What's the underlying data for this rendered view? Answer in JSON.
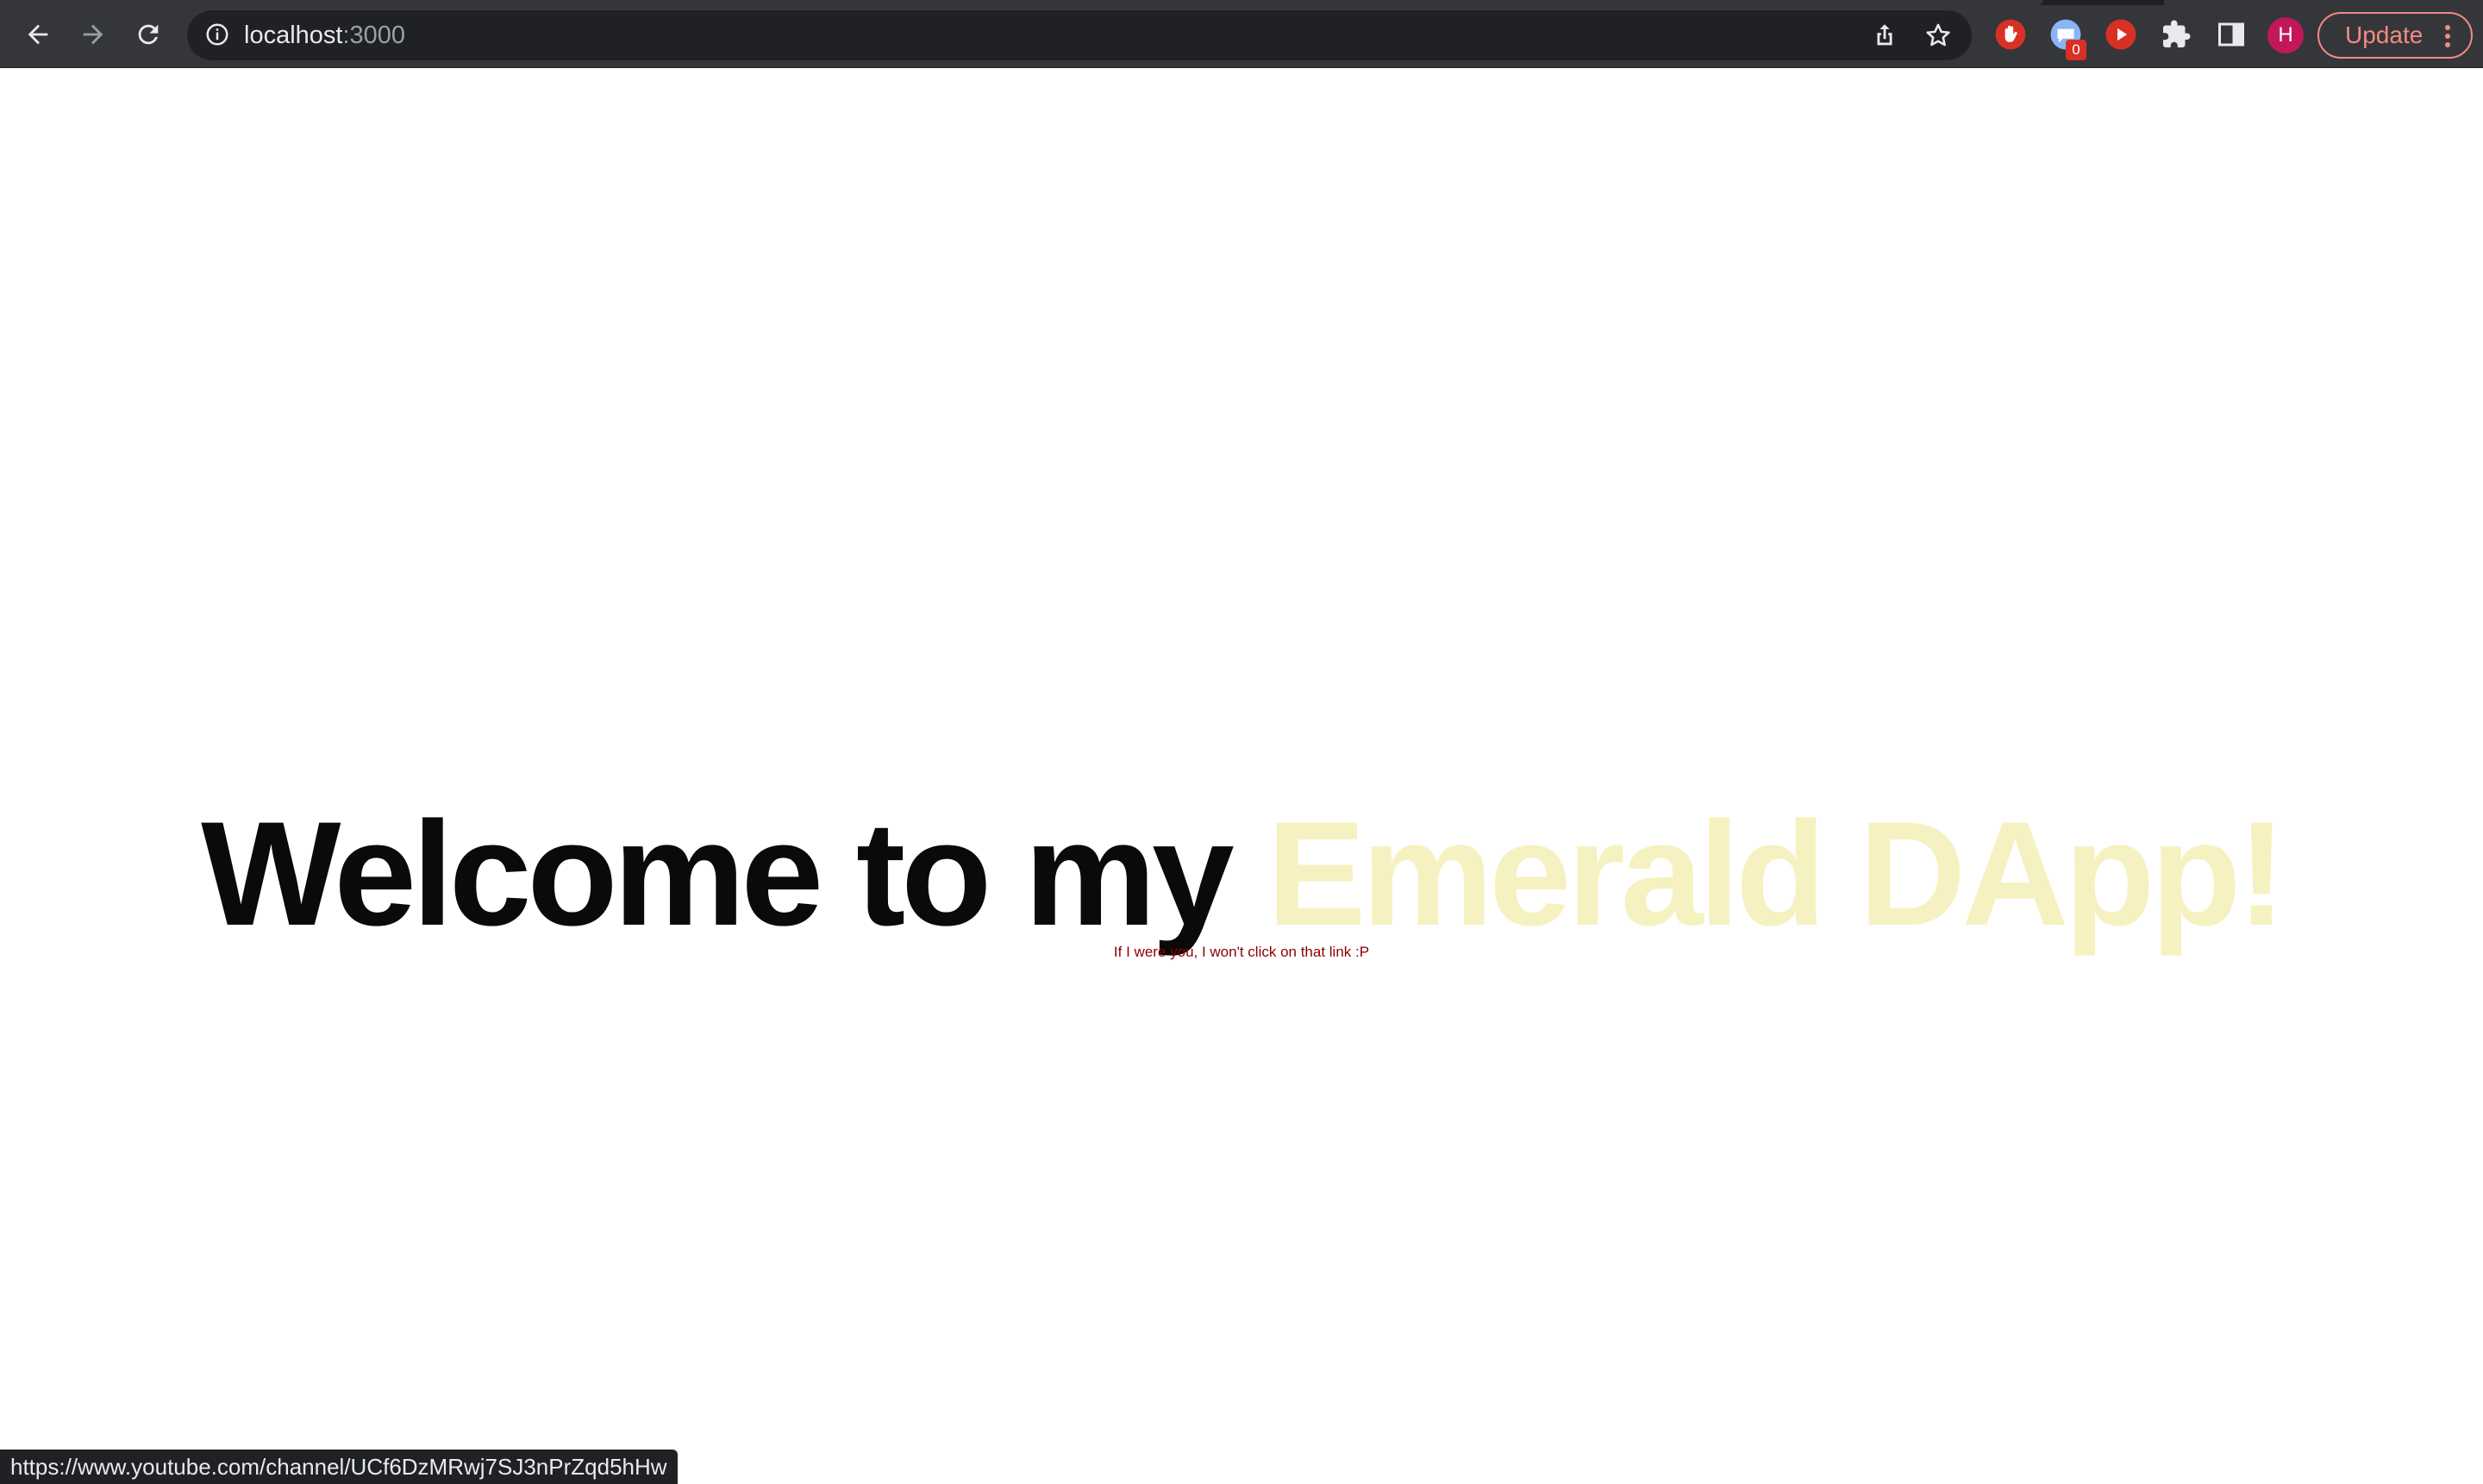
{
  "browser": {
    "url_host": "localhost",
    "url_port": ":3000",
    "extension_badge": "0",
    "avatar_initial": "H",
    "update_label": "Update",
    "icons": {
      "back": "arrow-left-icon",
      "forward": "arrow-right-icon",
      "reload": "reload-icon",
      "site_info": "info-icon",
      "share": "share-icon",
      "bookmark": "star-icon",
      "ext1": "hand-stop-icon",
      "ext2": "chat-bubble-icon",
      "ext3": "play-icon",
      "extensions": "puzzle-icon",
      "side_panel": "side-panel-icon",
      "menu": "kebab-menu-icon"
    }
  },
  "page": {
    "headline_main": "Welcome to my ",
    "headline_accent": "Emerald DApp!",
    "warning": "If I were you, I won't click on that link :P",
    "accent_color": "#f6f1c0",
    "warning_color": "#8b0000"
  },
  "status_bar": {
    "link_url": "https://www.youtube.com/channel/UCf6DzMRwj7SJ3nPrZqd5hHw"
  }
}
